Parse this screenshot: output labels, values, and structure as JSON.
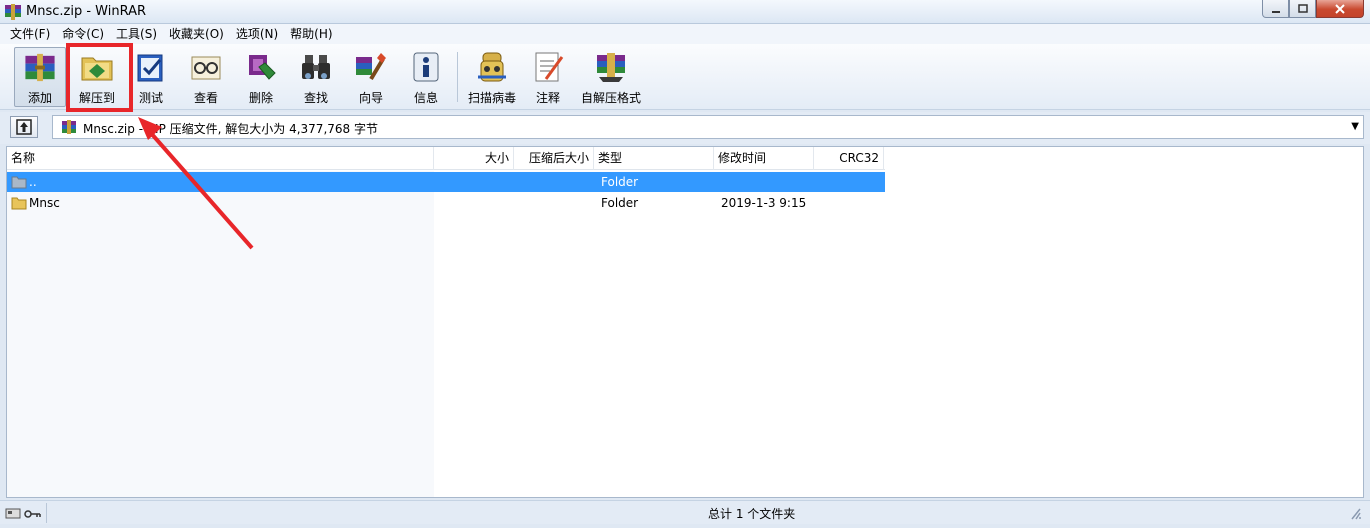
{
  "window": {
    "title": "Mnsc.zip - WinRAR"
  },
  "menu": [
    "文件(F)",
    "命令(C)",
    "工具(S)",
    "收藏夹(O)",
    "选项(N)",
    "帮助(H)"
  ],
  "toolbar": {
    "add": "添加",
    "extract": "解压到",
    "test": "测试",
    "view": "查看",
    "delete": "删除",
    "find": "查找",
    "wizard": "向导",
    "info": "信息",
    "virus_scan": "扫描病毒",
    "comment": "注释",
    "sfx": "自解压格式"
  },
  "address": {
    "archive": "Mnsc.zip",
    "description": " - ZIP 压缩文件, 解包大小为 4,377,768 字节"
  },
  "columns": {
    "name": "名称",
    "size": "大小",
    "packed": "压缩后大小",
    "type": "类型",
    "modified": "修改时间",
    "crc": "CRC32"
  },
  "rows": [
    {
      "name": "..",
      "size": "",
      "packed": "",
      "type": "Folder",
      "modified": "",
      "crc": ""
    },
    {
      "name": "Mnsc",
      "size": "",
      "packed": "",
      "type": "Folder",
      "modified": "2019-1-3 9:15",
      "crc": ""
    }
  ],
  "status": {
    "summary": "总计 1 个文件夹"
  },
  "colors": {
    "selection": "#3399ff",
    "annotation": "#e8262a"
  },
  "icons": {
    "app": "winrar-books-icon",
    "add": "winrar-books-icon",
    "extract": "folder-extract-icon",
    "test": "test-check-icon",
    "view": "glasses-icon",
    "delete": "recycle-delete-icon",
    "find": "binoculars-icon",
    "wizard": "wizard-wand-icon",
    "info": "info-icon",
    "virus_scan": "virus-scan-icon",
    "comment": "comment-note-icon",
    "sfx": "sfx-box-icon"
  }
}
